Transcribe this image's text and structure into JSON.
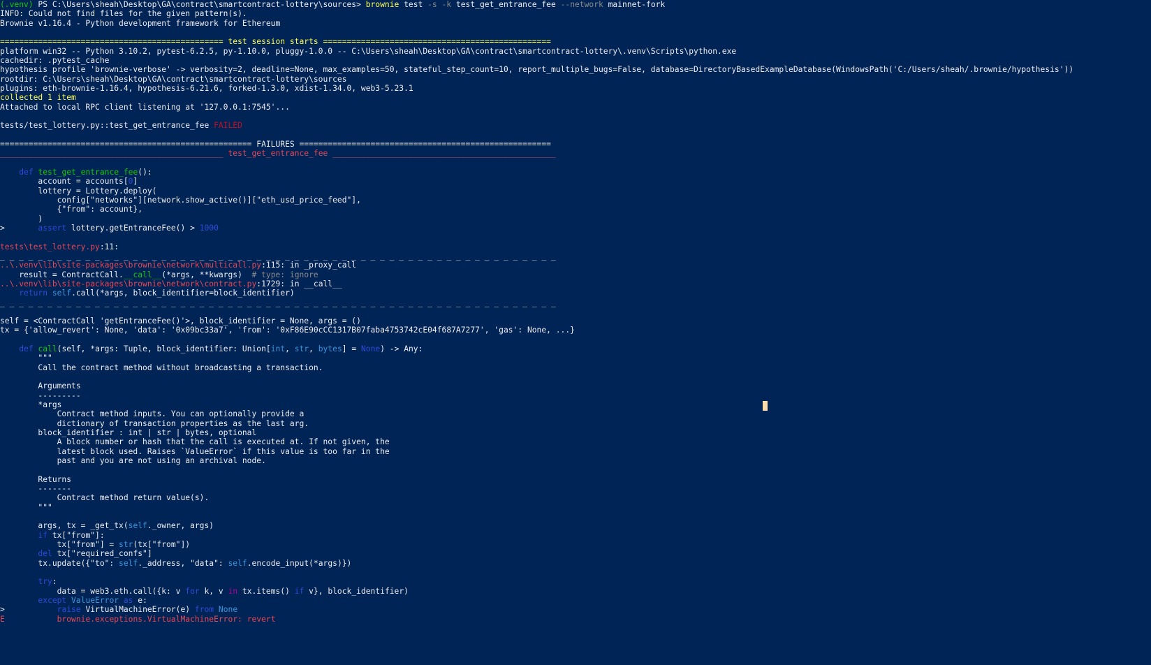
{
  "prompt": {
    "venv": "(.venv)",
    "path": " PS C:\\Users\\sheah\\Desktop\\GA\\contract\\smartcontract-lottery\\sources> ",
    "cmd_name": "brownie",
    "cmd_sub": " test ",
    "flag_s": "-s",
    "flag_k": " -k ",
    "test_name": "test_get_entrance_fee ",
    "flag_network": "--network",
    "network_value": " mainnet-fork"
  },
  "header": {
    "info": "INFO: Could not find files for the given pattern(s).",
    "brownie_version": "Brownie v1.16.4 - Python development framework for Ethereum"
  },
  "session": {
    "banner": "=============================================== test session starts ================================================",
    "platform": "platform win32 -- Python 3.10.2, pytest-6.2.5, py-1.10.0, pluggy-1.0.0 -- C:\\Users\\sheah\\Desktop\\GA\\contract\\smartcontract-lottery\\.venv\\Scripts\\python.exe",
    "cachedir": "cachedir: .pytest_cache",
    "hypothesis": "hypothesis profile 'brownie-verbose' -> verbosity=2, deadline=None, max_examples=50, stateful_step_count=10, report_multiple_bugs=False, database=DirectoryBasedExampleDatabase(WindowsPath('C:/Users/sheah/.brownie/hypothesis'))",
    "rootdir": "rootdir: C:\\Users\\sheah\\Desktop\\GA\\contract\\smartcontract-lottery\\sources",
    "plugins": "plugins: eth-brownie-1.16.4, hypothesis-6.21.6, forked-1.3.0, xdist-1.34.0, web3-5.23.1",
    "collected": "collected 1 item",
    "attached": "Attached to local RPC client listening at '127.0.0.1:7545'...",
    "test_path": "tests/test_lottery.py::test_get_entrance_fee ",
    "test_status": "FAILED"
  },
  "failures": {
    "banner": "===================================================== FAILURES =====================================================",
    "title_left": "_______________________________________________ ",
    "title": "test_get_entrance_fee",
    "title_right": " _______________________________________________"
  },
  "source1": {
    "def_kw": "def",
    "def_name": "test_get_entrance_fee",
    "def_tail": "():",
    "l2_a": "        account = accounts[",
    "l2_num": "0",
    "l2_b": "]",
    "l3": "        lottery = Lottery.deploy(",
    "l4": "            config[\"networks\"][network.show_active()][\"eth_usd_price_feed\"],",
    "l5": "            {\"from\": account},",
    "l6": "        )",
    "l7_marker": ">",
    "l7_kw": "assert",
    "l7_mid": " lottery.getEntranceFee() > ",
    "l7_num": "1000"
  },
  "location1": {
    "file": "tests\\test_lottery.py",
    "line": ":11:"
  },
  "separator": "_ _ _ _ _ _ _ _ _ _ _ _ _ _ _ _ _ _ _ _ _ _ _ _ _ _ _ _ _ _ _ _ _ _ _ _ _ _ _ _ _ _ _ _ _ _ _ _ _ _ _ _ _ _ _ _ _ _ _",
  "trace": {
    "f1_file": "..\\.venv\\lib\\site-packages\\brownie\\network\\multicall.py",
    "f1_tail": ":115: in _proxy_call",
    "f1_code_a": "    result = ContractCall.",
    "f1_code_fn": "__call__",
    "f1_code_b": "(*args, **kwargs)  ",
    "f1_comment": "# type: ignore",
    "f2_file": "..\\.venv\\lib\\site-packages\\brownie\\network\\contract.py",
    "f2_tail": ":1729: in __call__",
    "f2_kw": "return",
    "f2_self": "self",
    "f2_rest": ".call(*args, block_identifier=block_identifier)"
  },
  "locals": {
    "self_line": "self = <ContractCall 'getEntranceFee()'>, block_identifier = None, args = ()",
    "tx_line": "tx = {'allow_revert': None, 'data': '0x09bc33a7', 'from': '0xF86E90cCC1317B07faba4753742cE04f687A7277', 'gas': None, ...}"
  },
  "source2": {
    "def_kw": "def",
    "def_name": "call",
    "sig_a": "(self, *args: Tuple, block_identifier: Union[",
    "t_int": "int",
    "t_str": "str",
    "t_bytes": "bytes",
    "sig_b": "] = ",
    "none_kw": "None",
    "sig_c": ") -> Any:",
    "doc_open": "        \"\"\"",
    "doc1": "        Call the contract method without broadcasting a transaction.",
    "doc_args": "        Arguments",
    "doc_dash1": "        ---------",
    "doc_star": "        *args",
    "doc_a1": "            Contract method inputs. You can optionally provide a",
    "doc_a2": "            dictionary of transaction properties as the last arg.",
    "doc_bi": "        block_identifier : int | str | bytes, optional",
    "doc_b1": "            A block number or hash that the call is executed at. If not given, the",
    "doc_b2": "            latest block used. Raises `ValueError` if this value is too far in the",
    "doc_b3": "            past and you are not using an archival node.",
    "doc_ret": "        Returns",
    "doc_dash2": "        -------",
    "doc_r1": "            Contract method return value(s).",
    "doc_close": "        \"\"\"",
    "c1_a": "        args, tx = _get_tx(",
    "c1_self": "self",
    "c1_b": "._owner, args)",
    "c2_kw": "if",
    "c2_rest": " tx[\"from\"]:",
    "c3_a": "            tx[\"from\"] = ",
    "c3_fn": "str",
    "c3_b": "(tx[\"from\"])",
    "c4_kw": "del",
    "c4_rest": " tx[\"required_confs\"]",
    "c5_a": "        tx.update({\"to\": ",
    "c5_self1": "self",
    "c5_b": "._address, \"data\": ",
    "c5_self2": "self",
    "c5_c": ".encode_input(*args)})",
    "c6_kw": "try",
    "c6_rest": ":",
    "c7_a": "            data = web3.eth.call({k: v ",
    "c7_for": "for",
    "c7_b": " k, v ",
    "c7_in": "in",
    "c7_c": " tx.items() ",
    "c7_if": "if",
    "c7_d": " v}, block_identifier)",
    "c8_kw": "except",
    "c8_exc": "ValueError",
    "c8_as": "as",
    "c8_rest": " e:",
    "c9_marker": ">",
    "c9_kw": "raise",
    "c9_mid": " VirtualMachineError(e) ",
    "c9_from": "from",
    "c9_none": "None",
    "e_marker": "E",
    "e_msg": "brownie.exceptions.VirtualMachineError: revert"
  }
}
